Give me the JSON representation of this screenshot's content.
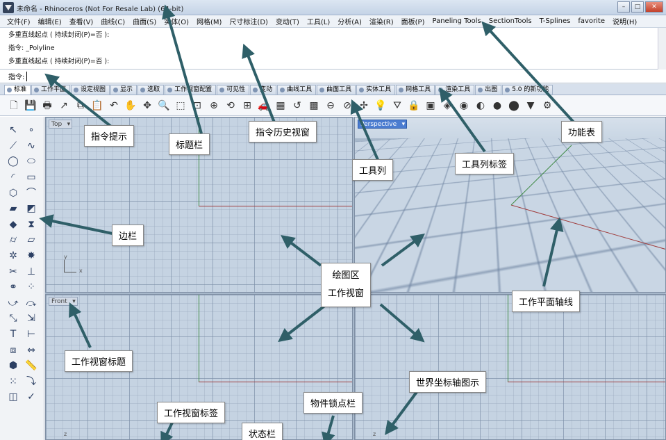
{
  "window": {
    "title": "未命名 - Rhinoceros (Not For Resale Lab) (64-bit)"
  },
  "menu": [
    "文件(F)",
    "编辑(E)",
    "查看(V)",
    "曲线(C)",
    "曲面(S)",
    "实体(O)",
    "网格(M)",
    "尺寸标注(D)",
    "变动(T)",
    "工具(L)",
    "分析(A)",
    "渲染(R)",
    "面板(P)",
    "Paneling Tools",
    "SectionTools",
    "T-Splines",
    "favorite",
    "说明(H)"
  ],
  "history": [
    "多重直线起点 ( 持续封闭(P)=否 ):",
    "指令: _Polyline",
    "多重直线起点 ( 持续封闭(P)=否 ):"
  ],
  "prompt": {
    "label": "指令:",
    "value": ""
  },
  "tabs": [
    "标准",
    "工作平面",
    "设定视图",
    "显示",
    "选取",
    "工作视窗配置",
    "可见性",
    "变动",
    "曲线工具",
    "曲面工具",
    "实体工具",
    "网格工具",
    "渲染工具",
    "出图",
    "5.0 的新功能"
  ],
  "toolbar_icons": [
    {
      "name": "new-file-icon",
      "glyph": "🗋"
    },
    {
      "name": "save-icon",
      "glyph": "💾"
    },
    {
      "name": "print-icon",
      "glyph": "🖶"
    },
    {
      "name": "import-icon",
      "glyph": "↗"
    },
    {
      "name": "copy-icon",
      "glyph": "⧉"
    },
    {
      "name": "paste-icon",
      "glyph": "📋"
    },
    {
      "name": "undo-icon",
      "glyph": "↶"
    },
    {
      "name": "pan-icon",
      "glyph": "✋"
    },
    {
      "name": "rotate-view-icon",
      "glyph": "✥"
    },
    {
      "name": "zoom-icon",
      "glyph": "🔍"
    },
    {
      "name": "zoom-window-icon",
      "glyph": "⬚"
    },
    {
      "name": "zoom-extents-icon",
      "glyph": "⊡"
    },
    {
      "name": "zoom-selected-icon",
      "glyph": "⊕"
    },
    {
      "name": "rotate-icon",
      "glyph": "⟲"
    },
    {
      "name": "four-view-icon",
      "glyph": "⊞"
    },
    {
      "name": "car-icon",
      "glyph": "🚗"
    },
    {
      "name": "grid-icon",
      "glyph": "▦"
    },
    {
      "name": "undo-view-icon",
      "glyph": "↺"
    },
    {
      "name": "grid-snap-icon",
      "glyph": "▩"
    },
    {
      "name": "minus-circle-icon",
      "glyph": "⊖"
    },
    {
      "name": "no-entry-icon",
      "glyph": "⊘"
    },
    {
      "name": "object-snap-icon",
      "glyph": "✢"
    },
    {
      "name": "light-bulb-icon",
      "glyph": "💡"
    },
    {
      "name": "filter-icon",
      "glyph": "⛛"
    },
    {
      "name": "lock-icon",
      "glyph": "🔒"
    },
    {
      "name": "layer-icon",
      "glyph": "▣"
    },
    {
      "name": "material-icon",
      "glyph": "◈"
    },
    {
      "name": "color-wheel-icon",
      "glyph": "◉"
    },
    {
      "name": "shade-icon",
      "glyph": "◐"
    },
    {
      "name": "sphere-icon",
      "glyph": "●"
    },
    {
      "name": "render-icon",
      "glyph": "⬤"
    },
    {
      "name": "funnel-icon",
      "glyph": "▼"
    },
    {
      "name": "gear-icon",
      "glyph": "⚙"
    }
  ],
  "sidebar_icons": [
    [
      {
        "name": "select-arrow-icon",
        "glyph": "↖"
      },
      {
        "name": "point-icon",
        "glyph": "∘"
      }
    ],
    [
      {
        "name": "polyline-icon",
        "glyph": "⟋"
      },
      {
        "name": "curve-icon",
        "glyph": "∿"
      }
    ],
    [
      {
        "name": "circle-icon",
        "glyph": "◯"
      },
      {
        "name": "ellipse-icon",
        "glyph": "⬭"
      }
    ],
    [
      {
        "name": "arc-icon",
        "glyph": "◜"
      },
      {
        "name": "rectangle-icon",
        "glyph": "▭"
      }
    ],
    [
      {
        "name": "polygon-icon",
        "glyph": "⬡"
      },
      {
        "name": "fillet-icon",
        "glyph": "⌒"
      }
    ],
    [
      {
        "name": "surface-icon",
        "glyph": "▰"
      },
      {
        "name": "extrude-icon",
        "glyph": "◩"
      }
    ],
    [
      {
        "name": "box-icon",
        "glyph": "◆"
      },
      {
        "name": "boolean-icon",
        "glyph": "⧗"
      }
    ],
    [
      {
        "name": "cylinder-icon",
        "glyph": "⌭"
      },
      {
        "name": "plane-icon",
        "glyph": "▱"
      }
    ],
    [
      {
        "name": "gear-tool-icon",
        "glyph": "✲"
      },
      {
        "name": "explode-icon",
        "glyph": "✸"
      }
    ],
    [
      {
        "name": "trim-icon",
        "glyph": "✂"
      },
      {
        "name": "split-icon",
        "glyph": "⊥"
      }
    ],
    [
      {
        "name": "join-icon",
        "glyph": "⚭"
      },
      {
        "name": "points-on-icon",
        "glyph": "⁘"
      }
    ],
    [
      {
        "name": "blend-icon",
        "glyph": "⤻"
      },
      {
        "name": "offset-icon",
        "glyph": "⤼"
      }
    ],
    [
      {
        "name": "move-icon",
        "glyph": "⤡"
      },
      {
        "name": "scale-icon",
        "glyph": "⇲"
      }
    ],
    [
      {
        "name": "text-icon",
        "glyph": "T"
      },
      {
        "name": "dimension-icon",
        "glyph": "⊢"
      }
    ],
    [
      {
        "name": "group-icon",
        "glyph": "⧈"
      },
      {
        "name": "mirror-icon",
        "glyph": "⇔"
      }
    ],
    [
      {
        "name": "mesh-box-icon",
        "glyph": "⬢"
      },
      {
        "name": "ruler-icon",
        "glyph": "📏"
      }
    ],
    [
      {
        "name": "array-icon",
        "glyph": "⁙"
      },
      {
        "name": "flow-icon",
        "glyph": "⤵"
      }
    ],
    [
      {
        "name": "analyze-icon",
        "glyph": "◫"
      },
      {
        "name": "check-icon",
        "glyph": "✓"
      }
    ]
  ],
  "viewports": {
    "top": "Top",
    "perspective": "Perspective",
    "front": "Front"
  },
  "axes": {
    "x": "x",
    "y": "y",
    "z": "z"
  },
  "annotations": {
    "command_prompt": "指令提示",
    "title_bar": "标题栏",
    "command_history": "指令历史视窗",
    "menu_bar": "功能表",
    "toolbar": "工具列",
    "toolbar_tabs": "工具列标签",
    "sidebar": "边栏",
    "drawing_area": "绘图区",
    "work_viewport": "工作视窗",
    "construction_plane_axes": "工作平面轴线",
    "viewport_title": "工作视窗标题",
    "world_axes_icon": "世界坐标轴图示",
    "object_snap_bar": "物件锁点栏",
    "viewport_tabs": "工作视窗标签",
    "status_bar": "状态栏"
  }
}
